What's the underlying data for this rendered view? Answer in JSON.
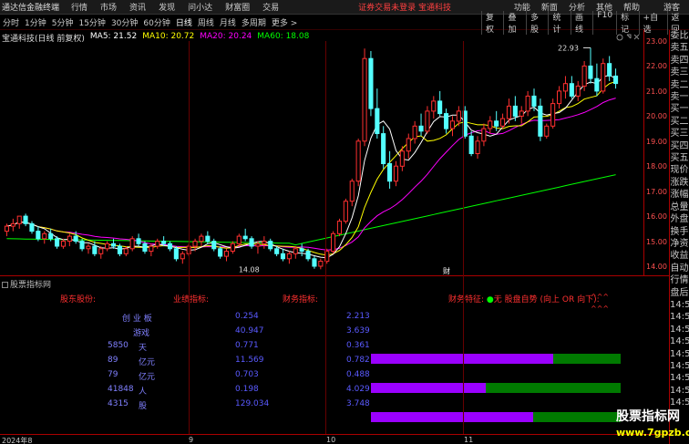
{
  "menubar": {
    "app": "通达信金融终端",
    "items": [
      "行情",
      "市场",
      "资讯",
      "发现",
      "问小达",
      "财富圈",
      "交易"
    ],
    "notice": "证券交易未登录  宝通科技",
    "right": [
      "功能",
      "新面",
      "分析",
      "其他",
      "帮助"
    ],
    "guest": "游客"
  },
  "toolbar": {
    "timeframes": [
      "分时",
      "1分钟",
      "5分钟",
      "15分钟",
      "30分钟",
      "60分钟",
      "日线",
      "周线",
      "月线",
      "多周期",
      "更多 >"
    ],
    "active": "日线",
    "tools": [
      "复权",
      "叠加",
      "多股",
      "统计",
      "画线",
      "F10",
      "标记",
      "+自选",
      "返回"
    ]
  },
  "stock": {
    "name": "宝通科技(日线 前复权)",
    "ma5": "MA5: 21.52",
    "ma10": "MA10: 20.72",
    "ma20": "MA20: 20.24",
    "ma60": "MA60: 18.08"
  },
  "price_axis": [
    "23.00",
    "22.00",
    "21.00",
    "20.00",
    "19.00",
    "18.00",
    "17.00",
    "16.00",
    "15.00",
    "14.00"
  ],
  "chart_data": {
    "type": "candlestick",
    "high_label": "22.93",
    "low_label": "14.08",
    "annotation": "财",
    "ylim": [
      13.8,
      23.2
    ],
    "up_color": "#ff3030",
    "down_color": "#54ffff",
    "candles": [
      [
        15.6,
        15.9,
        15.4,
        15.8
      ],
      [
        15.8,
        16.1,
        15.6,
        15.9
      ],
      [
        15.9,
        16.2,
        15.7,
        16.2
      ],
      [
        16.2,
        16.3,
        15.8,
        15.9
      ],
      [
        15.9,
        16.0,
        15.5,
        15.6
      ],
      [
        15.6,
        15.8,
        15.2,
        15.3
      ],
      [
        15.3,
        15.6,
        15.1,
        15.5
      ],
      [
        15.5,
        15.7,
        15.2,
        15.3
      ],
      [
        15.3,
        15.4,
        14.9,
        15.0
      ],
      [
        15.0,
        15.3,
        14.9,
        15.2
      ],
      [
        15.2,
        15.5,
        15.0,
        15.4
      ],
      [
        15.4,
        15.6,
        15.1,
        15.2
      ],
      [
        15.2,
        15.3,
        14.8,
        14.9
      ],
      [
        14.9,
        15.1,
        14.7,
        15.0
      ],
      [
        15.0,
        15.2,
        14.6,
        14.7
      ],
      [
        14.7,
        15.0,
        14.5,
        14.9
      ],
      [
        14.9,
        15.2,
        14.8,
        15.1
      ],
      [
        15.1,
        15.3,
        14.9,
        15.0
      ],
      [
        15.0,
        15.1,
        14.6,
        14.7
      ],
      [
        14.7,
        15.0,
        14.6,
        14.9
      ],
      [
        14.9,
        15.4,
        14.8,
        15.3
      ],
      [
        15.3,
        15.5,
        15.0,
        15.1
      ],
      [
        15.1,
        15.2,
        14.7,
        14.8
      ],
      [
        14.8,
        15.1,
        14.6,
        15.0
      ],
      [
        15.0,
        15.3,
        14.9,
        15.2
      ],
      [
        15.2,
        15.4,
        15.0,
        15.1
      ],
      [
        15.1,
        15.2,
        14.8,
        14.9
      ],
      [
        14.9,
        15.0,
        14.4,
        14.5
      ],
      [
        14.5,
        14.8,
        14.3,
        14.7
      ],
      [
        14.7,
        15.1,
        14.6,
        15.0
      ],
      [
        15.0,
        15.3,
        14.8,
        15.2
      ],
      [
        15.2,
        15.5,
        15.0,
        15.4
      ],
      [
        15.4,
        15.6,
        15.1,
        15.2
      ],
      [
        15.2,
        15.3,
        14.8,
        14.9
      ],
      [
        14.9,
        15.0,
        14.5,
        14.6
      ],
      [
        14.6,
        14.9,
        14.4,
        14.8
      ],
      [
        14.8,
        15.2,
        14.7,
        15.1
      ],
      [
        15.1,
        15.5,
        15.0,
        15.4
      ],
      [
        15.4,
        15.7,
        15.2,
        15.3
      ],
      [
        15.3,
        15.4,
        14.9,
        15.0
      ],
      [
        15.0,
        15.2,
        14.7,
        15.1
      ],
      [
        15.1,
        15.4,
        14.9,
        15.2
      ],
      [
        15.2,
        15.3,
        14.8,
        14.9
      ],
      [
        14.9,
        15.0,
        14.6,
        14.7
      ],
      [
        14.7,
        14.9,
        14.4,
        14.5
      ],
      [
        14.5,
        14.8,
        14.3,
        14.7
      ],
      [
        14.7,
        15.0,
        14.5,
        14.9
      ],
      [
        14.9,
        15.1,
        14.6,
        14.8
      ],
      [
        14.8,
        14.9,
        14.4,
        14.5
      ],
      [
        14.5,
        14.6,
        14.1,
        14.2
      ],
      [
        14.2,
        14.5,
        14.08,
        14.4
      ],
      [
        14.4,
        14.9,
        14.3,
        14.8
      ],
      [
        14.8,
        15.6,
        14.7,
        15.5
      ],
      [
        15.5,
        16.1,
        15.4,
        16.0
      ],
      [
        16.0,
        16.9,
        15.9,
        16.8
      ],
      [
        16.8,
        17.7,
        16.6,
        17.6
      ],
      [
        17.6,
        19.3,
        17.4,
        19.2
      ],
      [
        19.2,
        22.9,
        19.0,
        22.5
      ],
      [
        22.5,
        22.8,
        20.2,
        20.5
      ],
      [
        20.5,
        21.3,
        19.3,
        19.5
      ],
      [
        19.5,
        19.8,
        18.1,
        18.3
      ],
      [
        18.3,
        18.8,
        17.3,
        17.6
      ],
      [
        17.6,
        18.4,
        17.4,
        18.2
      ],
      [
        18.2,
        19.0,
        18.0,
        18.8
      ],
      [
        18.8,
        19.5,
        18.5,
        19.3
      ],
      [
        19.3,
        20.0,
        19.1,
        19.8
      ],
      [
        19.8,
        20.3,
        19.4,
        19.6
      ],
      [
        19.6,
        20.6,
        19.5,
        20.4
      ],
      [
        20.4,
        21.0,
        20.1,
        20.8
      ],
      [
        20.8,
        21.2,
        20.2,
        20.3
      ],
      [
        20.3,
        20.5,
        19.5,
        19.7
      ],
      [
        19.7,
        20.2,
        19.4,
        20.0
      ],
      [
        20.0,
        20.6,
        19.8,
        20.4
      ],
      [
        20.4,
        20.6,
        19.3,
        19.4
      ],
      [
        19.4,
        19.6,
        18.6,
        18.7
      ],
      [
        18.7,
        19.4,
        18.5,
        19.2
      ],
      [
        19.2,
        19.9,
        19.0,
        19.7
      ],
      [
        19.7,
        20.2,
        19.5,
        20.0
      ],
      [
        20.0,
        20.4,
        19.6,
        19.8
      ],
      [
        19.8,
        20.3,
        19.7,
        20.1
      ],
      [
        20.1,
        20.9,
        19.9,
        20.6
      ],
      [
        20.6,
        21.0,
        20.0,
        20.2
      ],
      [
        20.2,
        20.6,
        19.9,
        20.4
      ],
      [
        20.4,
        21.2,
        20.2,
        21.0
      ],
      [
        21.0,
        21.3,
        20.4,
        20.6
      ],
      [
        20.6,
        20.9,
        19.2,
        19.4
      ],
      [
        19.4,
        19.9,
        19.3,
        19.8
      ],
      [
        19.8,
        20.9,
        19.7,
        20.7
      ],
      [
        20.7,
        21.4,
        20.5,
        21.2
      ],
      [
        21.2,
        21.8,
        20.9,
        21.5
      ],
      [
        21.5,
        21.8,
        20.9,
        21.0
      ],
      [
        21.0,
        21.6,
        20.8,
        21.4
      ],
      [
        21.4,
        22.4,
        21.2,
        22.2
      ],
      [
        22.2,
        22.93,
        21.5,
        21.7
      ],
      [
        21.7,
        22.3,
        21.0,
        21.2
      ],
      [
        21.2,
        22.5,
        21.1,
        22.3
      ],
      [
        22.3,
        22.6,
        21.6,
        21.8
      ],
      [
        21.8,
        22.1,
        21.3,
        21.5
      ]
    ],
    "ma_series": [
      {
        "name": "MA5",
        "color": "#ffffff"
      },
      {
        "name": "MA10",
        "color": "#ffff00"
      },
      {
        "name": "MA20",
        "color": "#ff00ff"
      },
      {
        "name": "MA60",
        "color": "#00ff00"
      }
    ]
  },
  "rightpanel": [
    "委比",
    "卖五",
    "卖四",
    "卖三",
    "卖二",
    "卖一",
    "买一",
    "买二",
    "买三",
    "买四",
    "买五",
    "现价",
    "涨跌",
    "涨幅",
    "总量",
    "外盘",
    "换手",
    "净资",
    "收益",
    "",
    "自动",
    "行情",
    "盘后",
    "14:5",
    "14:5",
    "14:5",
    "14:5",
    "14:5",
    "14:5",
    "14:5",
    "14:5",
    "14:5"
  ],
  "indicator": {
    "title": "股票指标网",
    "headers": [
      "股东股份:",
      "业绩指标:",
      "财务指标:"
    ],
    "signal_label": "财务特征:",
    "signal_text": "无 股盘自势 (向上 OR 向下):",
    "arrow_marks": [
      "^^^",
      "^^^"
    ],
    "rows": [
      {
        "c1": "创 业 板",
        "c2": "",
        "v1": "0.254",
        "v2": "2.213"
      },
      {
        "c1": "游戏",
        "c2": "",
        "v1": "40.947",
        "v2": "3.639"
      },
      {
        "c1": "5850",
        "c2": "天",
        "v1": "0.771",
        "v2": "0.361"
      },
      {
        "c1": "89",
        "c2": "亿元",
        "v1": "11.569",
        "v2": "0.782"
      },
      {
        "c1": "79",
        "c2": "亿元",
        "v1": "0.703",
        "v2": "0.488"
      },
      {
        "c1": "41848",
        "c2": "人",
        "v1": "0.198",
        "v2": "4.029"
      },
      {
        "c1": "4315",
        "c2": "股",
        "v1": "129.034",
        "v2": "3.748"
      }
    ],
    "bars": [
      0.73,
      0.46,
      0.65
    ]
  },
  "date_axis": [
    "2024年8",
    "9",
    "10",
    "11"
  ],
  "watermark": {
    "name": "股票指标网",
    "url": "www.7gpzb.com"
  }
}
